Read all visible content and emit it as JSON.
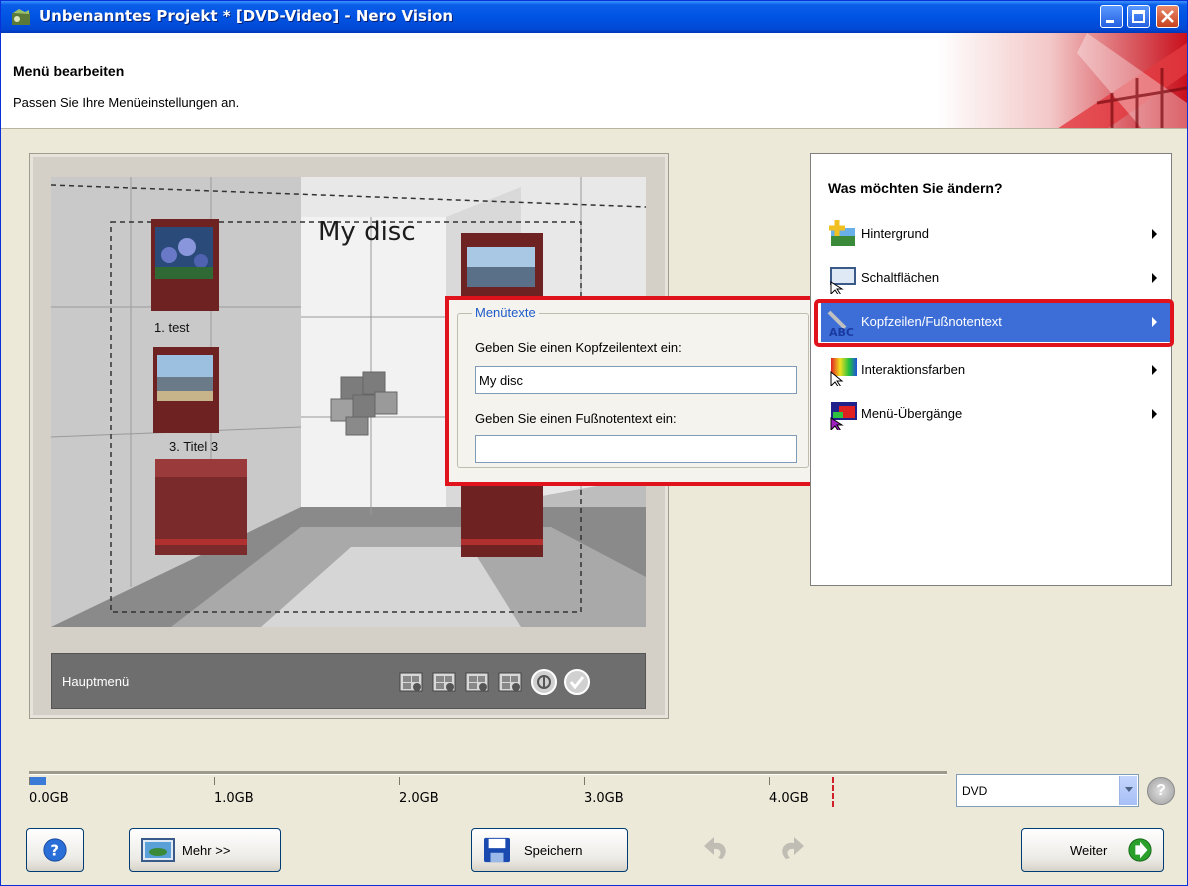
{
  "window": {
    "title": "Unbenanntes Projekt * [DVD-Video] - Nero Vision"
  },
  "header": {
    "title": "Menü bearbeiten",
    "subtitle": "Passen Sie Ihre Menüeinstellungen an."
  },
  "preview": {
    "menu_title": "My disc",
    "tiles": [
      {
        "label": "1. test"
      },
      {
        "label": "3. Titel 3"
      }
    ],
    "footer_label": "Hauptmenü"
  },
  "menutexte": {
    "legend": "Menütexte",
    "header_label": "Geben Sie einen Kopfzeilentext ein:",
    "header_value": "My disc",
    "footer_label": "Geben Sie einen Fußnotentext ein:",
    "footer_value": ""
  },
  "options": {
    "heading": "Was möchten Sie ändern?",
    "items": [
      {
        "label": "Hintergrund",
        "icon": "background-icon"
      },
      {
        "label": "Schaltflächen",
        "icon": "buttons-icon"
      },
      {
        "label": "Kopfzeilen/Fußnotentext",
        "icon": "text-abc-icon",
        "active": true
      },
      {
        "label": "Interaktionsfarben",
        "icon": "color-pointer-icon"
      },
      {
        "label": "Menü-Übergänge",
        "icon": "transition-icon"
      }
    ]
  },
  "capacity": {
    "labels": [
      "0.0GB",
      "1.0GB",
      "2.0GB",
      "3.0GB",
      "4.0GB"
    ],
    "used_fraction": 0.018
  },
  "disc_type": {
    "selected": "DVD"
  },
  "bottom": {
    "more_label": "Mehr >>",
    "save_label": "Speichern",
    "next_label": "Weiter"
  },
  "colors": {
    "highlight_frame": "#e0121b",
    "active_item": "#3d6ed8",
    "titlebar": "#0054e3"
  }
}
